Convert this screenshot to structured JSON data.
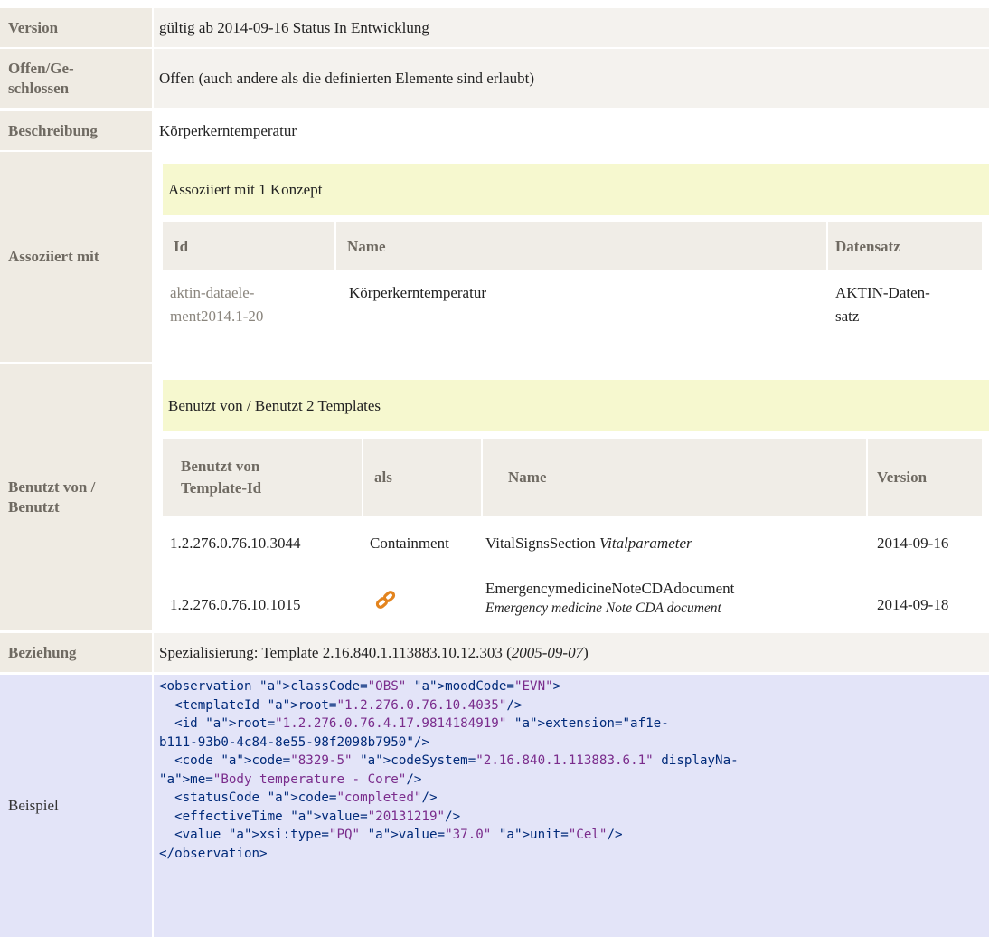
{
  "version": {
    "label": "Version",
    "value": "gültig ab 2014-09-16 Status In Entwicklung"
  },
  "open_closed": {
    "label": "Offen/Ge-\nschlossen",
    "value": "Offen (auch andere als die definierten Elemente sind erlaubt)"
  },
  "description": {
    "label": "Beschreibung",
    "value": "Körperkerntemperatur"
  },
  "associated": {
    "label": "Assoziiert mit",
    "banner": "Assoziiert mit 1 Konzept",
    "headers": [
      "Id",
      "Name",
      "Datensatz"
    ],
    "row": {
      "id": "aktin-dataele-\nment2014.1-20",
      "name": "Körperkerntemperatur",
      "dataset": "AKTIN-Daten-\nsatz"
    }
  },
  "used_by": {
    "label": "Benutzt von /\nBenutzt",
    "banner": "Benutzt von / Benutzt 2 Templates",
    "headers": [
      "Benutzt von\nTemplate-Id",
      "als",
      "Name",
      "Version"
    ],
    "rows": [
      {
        "template_id": "1.2.276.0.76.10.3044",
        "as": "Containment",
        "name": "VitalSignsSection",
        "name_italic": "Vitalparameter",
        "version": "2014-09-16"
      },
      {
        "template_id": "1.2.276.0.76.10.1015",
        "as_icon": "link-icon",
        "name": "EmergencymedicineNoteCDAdocument",
        "name_italic": "Emergency medicine Note CDA document",
        "version": "2014-09-18"
      }
    ]
  },
  "relation": {
    "label": "Beziehung",
    "prefix": "Spezialisierung: Template 2.16.840.1.113883.10.12.303 (",
    "date": "2005-09-07",
    "suffix": ")"
  },
  "example": {
    "label": "Beispiel",
    "lines": [
      "<observation classCode=\"OBS\" moodCode=\"EVN\">",
      "  <templateId root=\"1.2.276.0.76.10.4035\"/>",
      "  <id root=\"1.2.276.0.76.4.17.9814184919\" extension=\"af1e-",
      "b111-93b0-4c84-8e55-98f2098b7950\"/>",
      "  <code code=\"8329-5\" codeSystem=\"2.16.840.1.113883.6.1\" displayNa-",
      "me=\"Body temperature - Core\"/>",
      "  <statusCode code=\"completed\"/>",
      "  <effectiveTime value=\"20131219\"/>",
      "  <value xsi:type=\"PQ\" value=\"37.0\" unit=\"Cel\"/>",
      "</observation>"
    ]
  },
  "colors": {
    "label_bg": "#efebe3",
    "banner_bg": "#f6f8cf",
    "code_bg": "#e3e4f8",
    "attr": "#c66d1f",
    "tag": "#002a7a"
  }
}
